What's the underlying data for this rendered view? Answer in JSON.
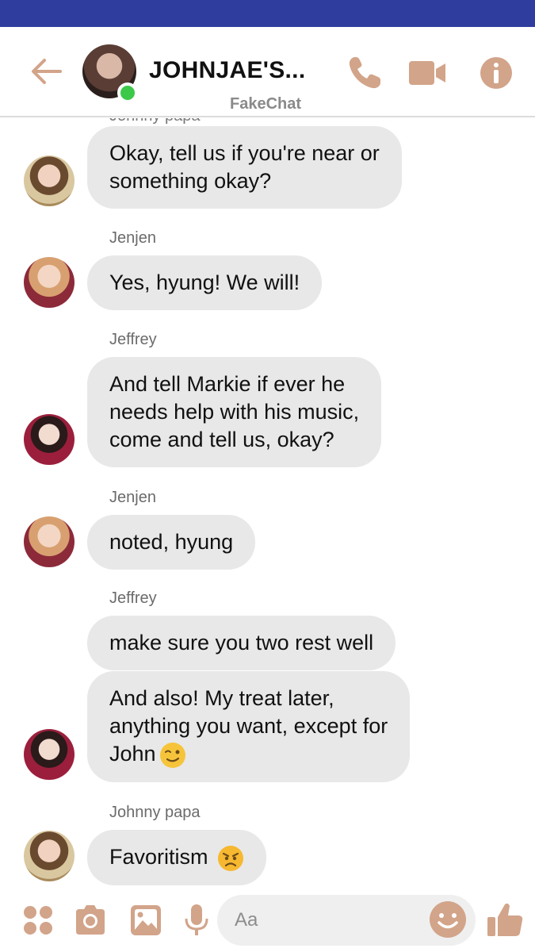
{
  "header": {
    "title": "JOHNJAE'S...",
    "subtitle": "FakeChat",
    "accent_color": "#d2a48a",
    "online_color": "#3cc94a",
    "icons": [
      "back-arrow-icon",
      "phone-icon",
      "video-camera-icon",
      "info-icon"
    ]
  },
  "conversation": {
    "cut_off_sender": "Johnny papa",
    "messages": [
      {
        "sender": "",
        "text": "Okay, tell us if you're near or\nsomething okay?"
      },
      {
        "sender": "Jenjen",
        "text": "Yes, hyung! We will!"
      },
      {
        "sender": "Jeffrey",
        "text": "And tell Markie if ever he\nneeds help with his music,\ncome and tell us, okay?"
      },
      {
        "sender": "Jenjen",
        "text": "noted, hyung"
      },
      {
        "sender": "Jeffrey",
        "text": "make sure you two rest well"
      },
      {
        "sender": "",
        "text": "And also!  My treat later,\nanything you want, except for\nJohn",
        "emoji": "winking-face-emoji"
      },
      {
        "sender": "Johnny papa",
        "text": "Favoritism",
        "emoji": "angry-face-emoji"
      }
    ]
  },
  "composer": {
    "placeholder": "Aa",
    "icons": [
      "apps-icon",
      "camera-icon",
      "image-icon",
      "microphone-icon",
      "smiley-icon",
      "thumbs-up-icon"
    ]
  }
}
